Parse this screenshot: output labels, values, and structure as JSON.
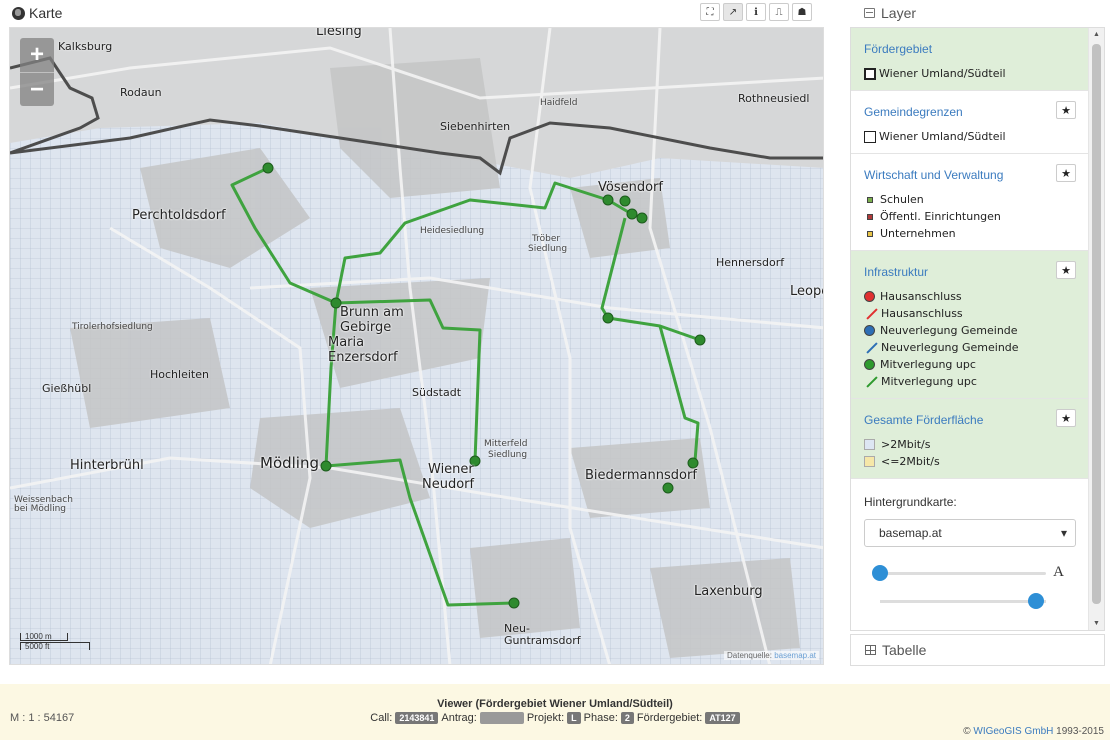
{
  "map": {
    "title": "Karte",
    "tools": [
      "⛶",
      "↗",
      "ℹ",
      "⎍",
      "☗"
    ],
    "zoom_in": "+",
    "zoom_out": "−",
    "scale_m": "1000 m",
    "scale_ft": "5000 ft",
    "attribution_text": "Datenquelle:",
    "attribution_link": "basemap.at",
    "places": [
      {
        "text": "Kalksburg",
        "size": "md"
      },
      {
        "text": "Rodaun",
        "size": "md"
      },
      {
        "text": "Liesing",
        "size": "lg"
      },
      {
        "text": "Siebenhirten",
        "size": "md"
      },
      {
        "text": "Haidfeld",
        "size": "sm"
      },
      {
        "text": "Rothneusiedl",
        "size": "md"
      },
      {
        "text": "Perchtoldsdorf",
        "size": "lg"
      },
      {
        "text": "Vösendorf",
        "size": "lg"
      },
      {
        "text": "Hennersdorf",
        "size": "md"
      },
      {
        "text": "Leopo",
        "size": "lg"
      },
      {
        "text": "Tirolerhofsiedlung",
        "size": "sm"
      },
      {
        "text": "Brunn am",
        "size": "lg"
      },
      {
        "text": "Gebirge",
        "size": "lg"
      },
      {
        "text": "Maria",
        "size": "lg"
      },
      {
        "text": "Enzersdorf",
        "size": "lg"
      },
      {
        "text": "Gießhübl",
        "size": "md"
      },
      {
        "text": "Hochleiten",
        "size": "md"
      },
      {
        "text": "Südstadt",
        "size": "md"
      },
      {
        "text": "Hinterbrühl",
        "size": "lg"
      },
      {
        "text": "Mödling",
        "size": "xl"
      },
      {
        "text": "Wiener",
        "size": "lg"
      },
      {
        "text": "Neudorf",
        "size": "lg"
      },
      {
        "text": "Mitterfeld",
        "size": "sm"
      },
      {
        "text": "Siedlung",
        "size": "sm"
      },
      {
        "text": "Biedermannsdorf",
        "size": "lg"
      },
      {
        "text": "Weissenbach",
        "size": "sm"
      },
      {
        "text": "bei Mödling",
        "size": "sm"
      },
      {
        "text": "Laxenburg",
        "size": "lg"
      },
      {
        "text": "Neu-",
        "size": "md"
      },
      {
        "text": "Guntramsdorf",
        "size": "md"
      },
      {
        "text": "Heidesiedlung",
        "size": "sm"
      },
      {
        "text": "Tröber",
        "size": "sm"
      },
      {
        "text": "Siedlung",
        "size": "sm"
      }
    ]
  },
  "layers": {
    "title": "Layer",
    "sections": [
      {
        "title": "Fördergebiet",
        "green": true,
        "star": false,
        "items": [
          {
            "label": "Wiener Umland/Südteil",
            "marker": "box-thick",
            "color": "#222"
          }
        ]
      },
      {
        "title": "Gemeindegrenzen",
        "green": false,
        "star": true,
        "items": [
          {
            "label": "Wiener Umland/Südteil",
            "marker": "box",
            "color": "#222"
          }
        ]
      },
      {
        "title": "Wirtschaft und Verwaltung",
        "green": false,
        "star": true,
        "items": [
          {
            "label": "Schulen",
            "marker": "sq",
            "color": "#7bb04d"
          },
          {
            "label": "Öffentl. Einrichtungen",
            "marker": "sq",
            "color": "#b03a3a"
          },
          {
            "label": "Unternehmen",
            "marker": "sq",
            "color": "#e8c547"
          }
        ]
      },
      {
        "title": "Infrastruktur",
        "green": true,
        "star": true,
        "items": [
          {
            "label": "Hausanschluss",
            "marker": "dot",
            "color": "#e03030"
          },
          {
            "label": "Hausanschluss",
            "marker": "slash",
            "color": "#e03030"
          },
          {
            "label": "Neuverlegung Gemeinde",
            "marker": "dot",
            "color": "#2e6fb5"
          },
          {
            "label": "Neuverlegung Gemeinde",
            "marker": "slash",
            "color": "#2e6fb5"
          },
          {
            "label": "Mitverlegung upc",
            "marker": "dot",
            "color": "#2e9a2e"
          },
          {
            "label": "Mitverlegung upc",
            "marker": "slash",
            "color": "#2e9a2e"
          }
        ]
      },
      {
        "title": "Gesamte Förderfläche",
        "green": true,
        "star": true,
        "items": [
          {
            "label": ">2Mbit/s",
            "marker": "fill",
            "color": "#dde6f3"
          },
          {
            "label": "<=2Mbit/s",
            "marker": "fill",
            "color": "#f6e7a8"
          }
        ]
      }
    ],
    "basemap_label": "Hintergrundkarte:",
    "basemap_value": "basemap.at",
    "opacity_label": "A",
    "star": "★"
  },
  "tabelle": {
    "title": "Tabelle"
  },
  "footer": {
    "scale": "M : 1 : 54167",
    "title": "Viewer (Fördergebiet Wiener Umland/Südteil)",
    "call_label": "Call:",
    "call_value": "2143841",
    "antrag_label": "Antrag:",
    "projekt_label": "Projekt:",
    "projekt_value": "L",
    "phase_label": "Phase:",
    "phase_value": "2",
    "foerder_label": "Fördergebiet:",
    "foerder_value": "AT127",
    "copyright_prefix": "©",
    "copyright_link": "WIGeoGIS GmbH",
    "copyright_years": "1993-2015"
  },
  "colors": {
    "route": "#3fa33f",
    "border": "#4d4d4d",
    "accent": "#3b7bbf"
  }
}
